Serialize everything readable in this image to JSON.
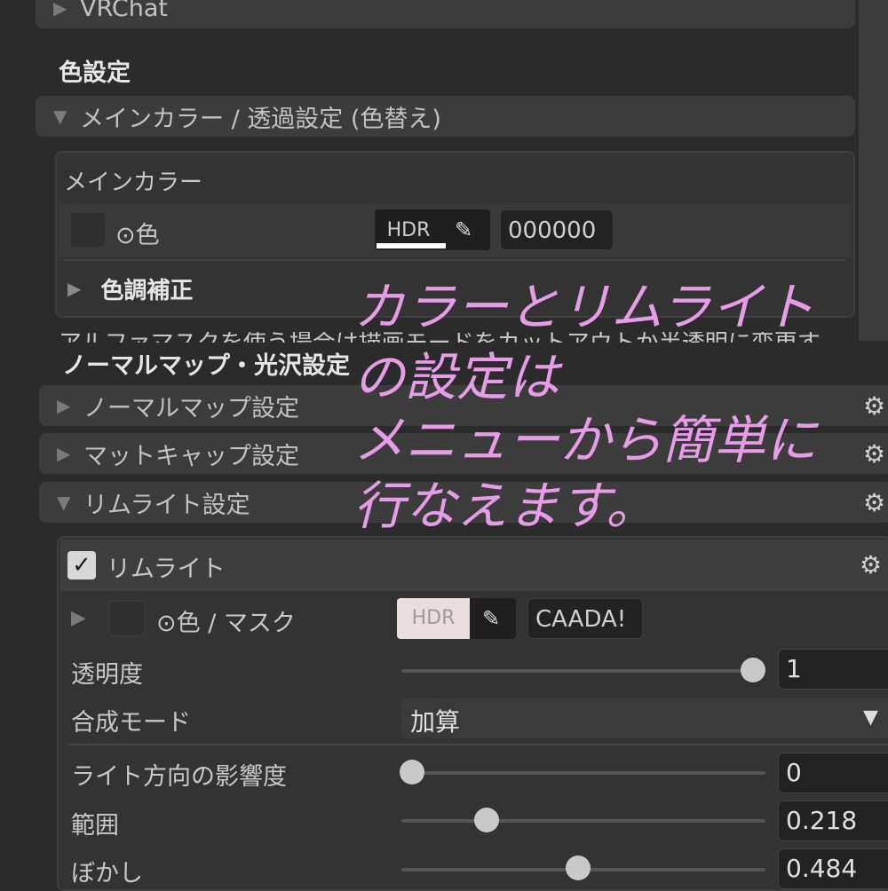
{
  "top_fold": {
    "label": "VRChat"
  },
  "color_section": {
    "title": "色設定"
  },
  "main_color_fold": {
    "label": "メインカラー / 透過設定 (色替え)"
  },
  "main_color_box": {
    "title": "メインカラー",
    "color_label": "⊙色",
    "hdr_label": "HDR",
    "hex_value": "000000",
    "tone_fold": "色調補正",
    "cutoff_text": "アルファマスクを使う場合は描画モードをカットアウトか半透明に変更す"
  },
  "normal_section": {
    "title": "ノーマルマップ・光沢設定"
  },
  "folds": [
    {
      "label": "ノーマルマップ設定"
    },
    {
      "label": "マットキャップ設定"
    },
    {
      "label": "リムライト設定"
    }
  ],
  "rim_box": {
    "toggle_label": "リムライト",
    "toggle_checked": true,
    "color_label": "⊙色 / マスク",
    "hdr_label": "HDR",
    "hex_value": "CAADA!",
    "rows": [
      {
        "label": "透明度",
        "value": "1",
        "fraction": 1.0
      },
      {
        "label": "合成モード",
        "dropdown": "加算"
      },
      {
        "label": "ライト方向の影響度",
        "value": "0",
        "fraction": 0.0
      },
      {
        "label": "範囲",
        "value": "0.218",
        "fraction": 0.218
      },
      {
        "label": "ぼかし",
        "value": "0.484",
        "fraction": 0.484
      }
    ]
  },
  "overlay": {
    "lines": [
      "カラーとリムライト",
      "の設定は",
      "メニューから簡単に",
      "行なえます。"
    ],
    "color": "#e79ce8"
  },
  "colors": {
    "rim_color": "#caadad",
    "panel": "#2b2b2b"
  }
}
